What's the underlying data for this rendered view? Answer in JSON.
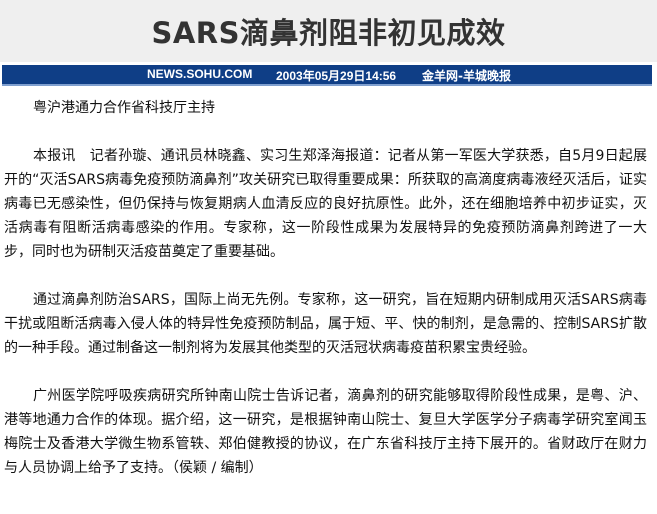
{
  "headline": "SARS滴鼻剂阻非初见成效",
  "meta": {
    "site": "NEWS.SOHU.COM",
    "date": "2003年05月29日14:56",
    "source": "金羊网-羊城晚报"
  },
  "article": {
    "subtitle": "粤沪港通力合作省科技厅主持",
    "paragraphs": [
      "本报讯　记者孙璇、通讯员林晓鑫、实习生郑泽海报道：记者从第一军医大学获悉，自5月9日起展开的“灭活SARS病毒免疫预防滴鼻剂”攻关研究已取得重要成果：所获取的高滴度病毒液经灭活后，证实病毒已无感染性，但仍保持与恢复期病人血清反应的良好抗原性。此外，还在细胞培养中初步证实，灭活病毒有阻断活病毒感染的作用。专家称，这一阶段性成果为发展特异的免疫预防滴鼻剂跨进了一大步，同时也为研制灭活疫苗奠定了重要基础。",
      "通过滴鼻剂防治SARS，国际上尚无先例。专家称，这一研究，旨在短期内研制成用灭活SARS病毒干扰或阻断活病毒入侵人体的特异性免疫预防制品，属于短、平、快的制剂，是急需的、控制SARS扩散的一种手段。通过制备这一制剂将为发展其他类型的灭活冠状病毒疫苗积累宝贵经验。",
      "广州医学院呼吸疾病研究所钟南山院士告诉记者，滴鼻剂的研究能够取得阶段性成果，是粤、沪、港等地通力合作的体现。据介绍，这一研究，是根据钟南山院士、复旦大学医学分子病毒学研究室闻玉梅院士及香港大学微生物系管轶、郑伯健教授的协议，在广东省科技厅主持下展开的。省财政厅在财力与人员协调上给予了支持。（侯颖 / 编制）"
    ]
  },
  "colors": {
    "title_bar_bg": "#efefef",
    "meta_bar_bg": "#0f3e86",
    "meta_text": "#ffffff"
  }
}
